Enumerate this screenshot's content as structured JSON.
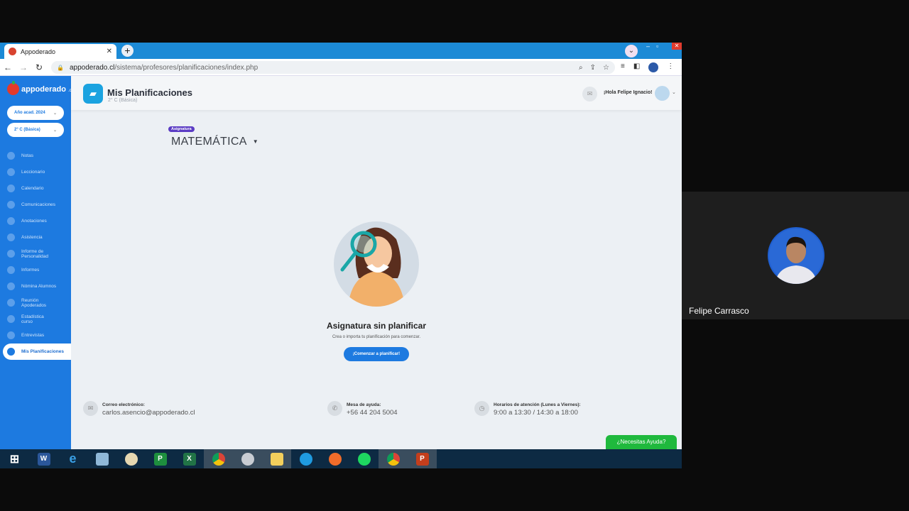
{
  "browser": {
    "tab_title": "Appoderado",
    "url_domain": "appoderado.cl",
    "url_path": "/sistema/profesores/planificaciones/index.php"
  },
  "sidebar": {
    "logo_text": "appoderado",
    "logo_suffix": ".com",
    "year_select": "Año acad. 2024",
    "course_select": "2° C (Básica)",
    "items": [
      {
        "label": "Notas",
        "icon": "star-icon"
      },
      {
        "label": "Leccionario",
        "icon": "book-icon"
      },
      {
        "label": "Calendario",
        "icon": "calendar-icon"
      },
      {
        "label": "Comunicaciones",
        "icon": "chat-icon"
      },
      {
        "label": "Anotaciones",
        "icon": "note-icon"
      },
      {
        "label": "Asistencia",
        "icon": "person-icon"
      },
      {
        "label": "Informe de Personalidad",
        "icon": "face-icon"
      },
      {
        "label": "Informes",
        "icon": "document-icon"
      },
      {
        "label": "Nómina Alumnos",
        "icon": "students-icon"
      },
      {
        "label": "Reunión Apoderados",
        "icon": "meeting-icon"
      },
      {
        "label": "Estadística curso",
        "icon": "stats-icon"
      },
      {
        "label": "Entrevistas",
        "icon": "interview-icon"
      },
      {
        "label": "Mis Planificaciones",
        "icon": "folder-icon",
        "active": true
      }
    ]
  },
  "header": {
    "title": "Mis Planificaciones",
    "subtitle": "2° C (Básica)",
    "greeting": "¡Hola Felipe Ignacio!"
  },
  "subject": {
    "badge": "Asignatura",
    "name": "MATEMÁTICA"
  },
  "empty_state": {
    "title": "Asignatura sin planificar",
    "subtitle": "Crea o importa tu planificación para comenzar.",
    "cta": "¡Comenzar a planificar!"
  },
  "footer": {
    "email_label": "Correo electrónico:",
    "email_value": "carlos.asencio@appoderado.cl",
    "help_label": "Mesa de ayuda:",
    "help_value": "+56 44 204 5004",
    "hours_label": "Horarios de atención (Lunes a Viernes):",
    "hours_value": "9:00 a 13:30 / 14:30 a 18:00"
  },
  "help_button": "¿Necesitas Ayuda?",
  "video": {
    "participant_name": "Felipe Carrasco"
  },
  "taskbar": [
    "windows-start",
    "word",
    "internet-explorer",
    "notes",
    "paint",
    "project",
    "excel",
    "chrome",
    "app",
    "file-explorer",
    "edge",
    "firefox",
    "spotify",
    "chrome-active",
    "powerpoint"
  ]
}
